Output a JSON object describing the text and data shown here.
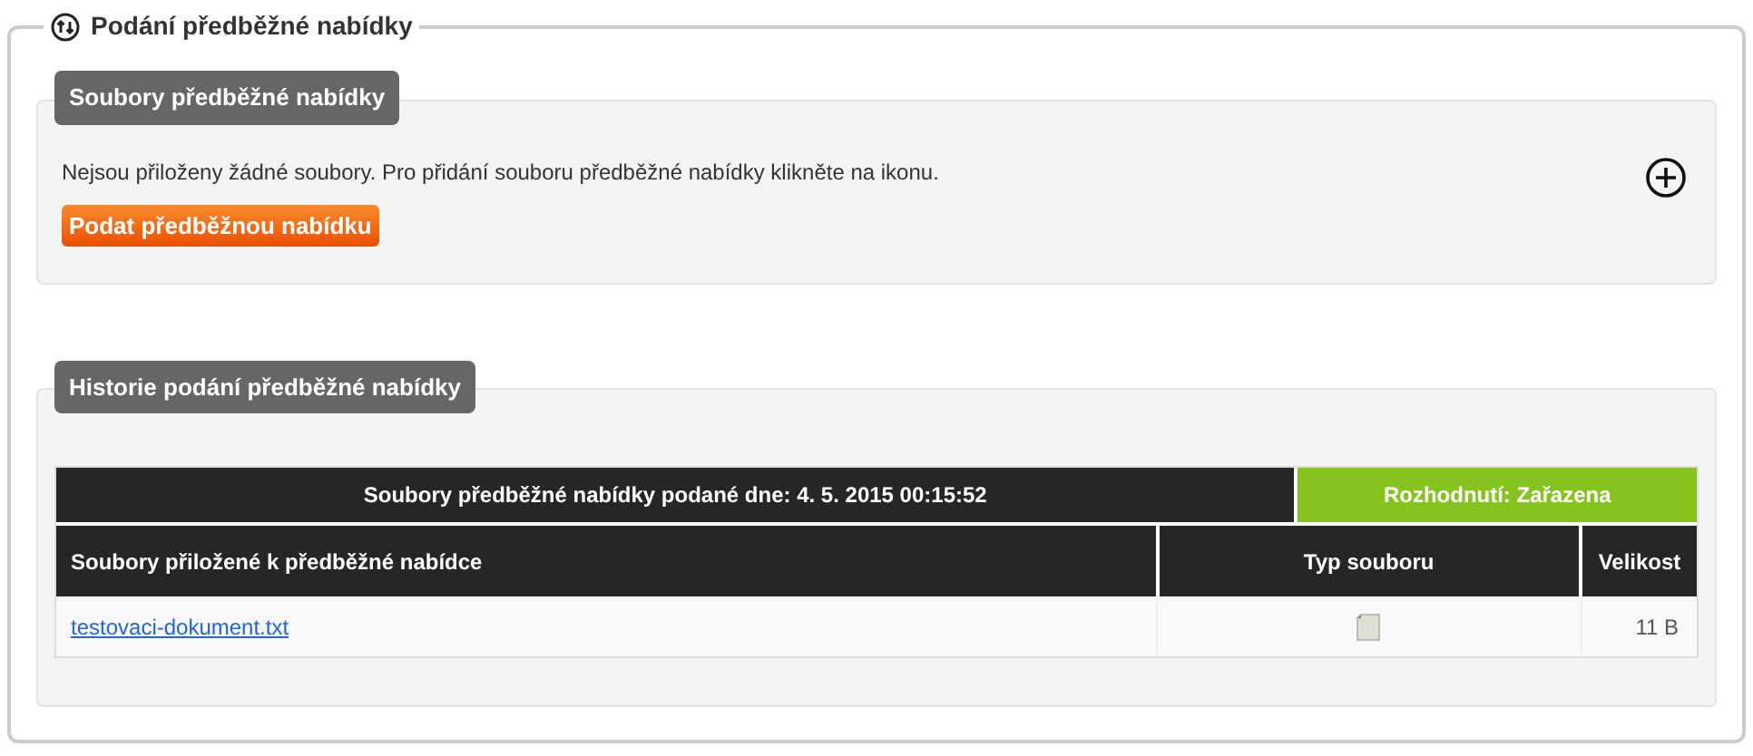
{
  "title": "Podání předběžné nabídky",
  "files_section": {
    "heading": "Soubory předběžné nabídky",
    "message": "Nejsou přiloženy žádné soubory. Pro přidání souboru předběžné nabídky klikněte na ikonu.",
    "submit_button": "Podat předběžnou nabídku"
  },
  "history_section": {
    "heading": "Historie podání předběžné nabídky",
    "table": {
      "submitted_header": "Soubory předběžné nabídky podané dne: 4. 5. 2015 00:15:52",
      "decision": "Rozhodnutí: Zařazena",
      "columns": [
        "Soubory přiložené k předběžné nabídce",
        "Typ souboru",
        "Velikost"
      ],
      "rows": [
        {
          "name": "testovaci-dokument.txt",
          "size": "11 B"
        }
      ]
    }
  }
}
